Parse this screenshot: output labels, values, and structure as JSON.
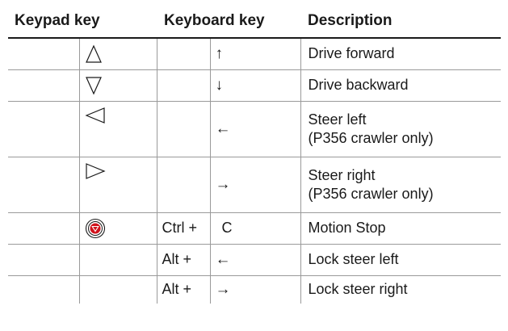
{
  "headers": {
    "keypad": "Keypad key",
    "keyboard": "Keyboard key",
    "description": "Description"
  },
  "rows": [
    {
      "keypad_icon": "triangle-up-outline-icon",
      "modifier": "",
      "key": "↑",
      "description": "Drive forward",
      "note": ""
    },
    {
      "keypad_icon": "triangle-down-outline-icon",
      "modifier": "",
      "key": "↓",
      "description": "Drive backward",
      "note": ""
    },
    {
      "keypad_icon": "triangle-left-outline-icon",
      "modifier": "",
      "key": "←",
      "description": "Steer left",
      "note": "(P356 crawler only)"
    },
    {
      "keypad_icon": "triangle-right-outline-icon",
      "modifier": "",
      "key": "→",
      "description": "Steer right",
      "note": "(P356 crawler only)"
    },
    {
      "keypad_icon": "motion-stop-icon",
      "modifier": "Ctrl +",
      "key": "C",
      "description": "Motion Stop",
      "note": ""
    },
    {
      "keypad_icon": "",
      "modifier": "Alt +",
      "key": "←",
      "description": "Lock steer left",
      "note": ""
    },
    {
      "keypad_icon": "",
      "modifier": "Alt +",
      "key": "→",
      "description": "Lock steer right",
      "note": ""
    }
  ],
  "colors": {
    "rule": "#1a1a1a",
    "grid": "#9a9a9a",
    "stop_red": "#d0121b"
  }
}
